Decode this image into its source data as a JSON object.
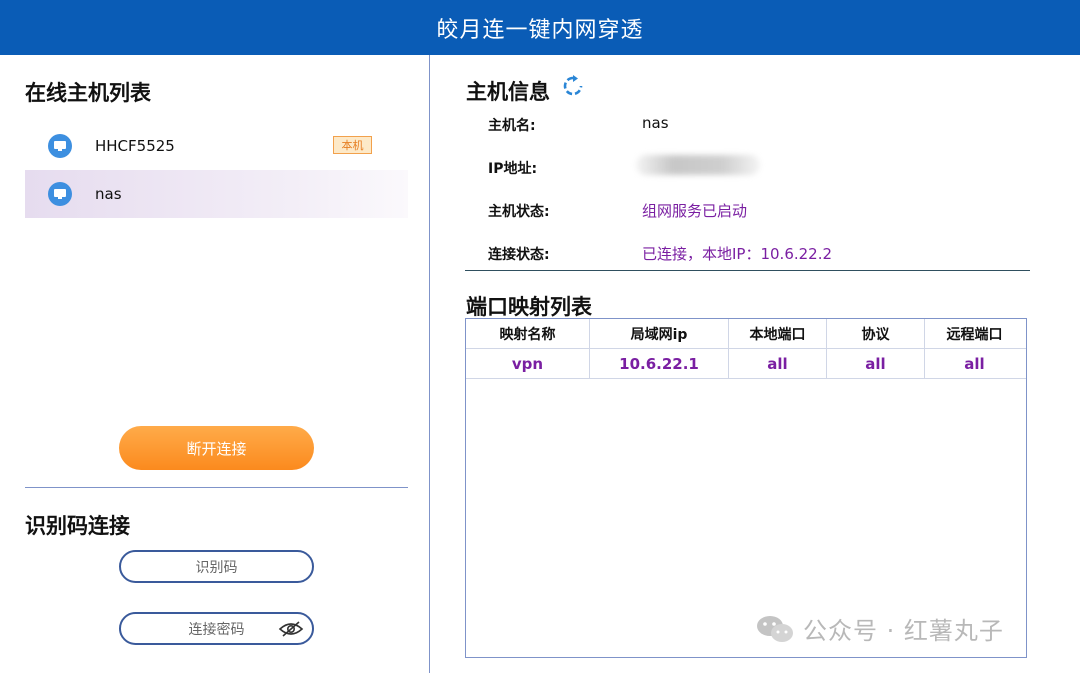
{
  "app": {
    "title": "皎月连一键内网穿透"
  },
  "hosts": {
    "title": "在线主机列表",
    "items": [
      {
        "name": "HHCF5525",
        "badge": "本机"
      },
      {
        "name": "nas"
      }
    ],
    "disconnect_label": "断开连接"
  },
  "code_connect": {
    "title": "识别码连接",
    "code_placeholder": "识别码",
    "password_placeholder": "连接密码"
  },
  "host_info": {
    "title": "主机信息",
    "rows": [
      {
        "label": "主机名:",
        "value": "nas"
      },
      {
        "label": "IP地址:",
        "value": ""
      },
      {
        "label": "主机状态:",
        "value": "组网服务已启动"
      },
      {
        "label": "连接状态:",
        "value": "已连接，本地IP：10.6.22.2"
      }
    ]
  },
  "port_map": {
    "title": "端口映射列表",
    "columns": [
      "映射名称",
      "局域网ip",
      "本地端口",
      "协议",
      "远程端口"
    ],
    "rows": [
      [
        "vpn",
        "10.6.22.1",
        "all",
        "all",
        "all"
      ]
    ]
  },
  "watermark": {
    "text": "公众号 · 红薯丸子"
  },
  "colors": {
    "titlebar": "#0a5cb6",
    "accent_orange": "#fb8a1e",
    "status_purple": "#7a1fa2"
  }
}
